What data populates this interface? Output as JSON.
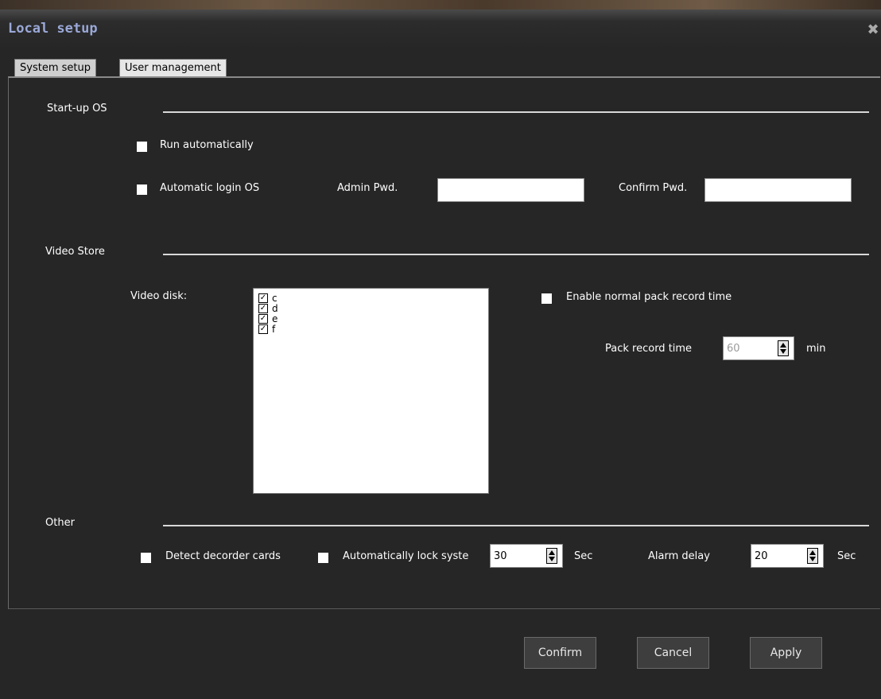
{
  "window": {
    "title": "Local setup",
    "close_icon": "close-icon"
  },
  "tabs": [
    {
      "label": "System setup",
      "selected": false
    },
    {
      "label": "User management",
      "selected": true
    }
  ],
  "startup": {
    "section_label": "Start-up OS",
    "run_auto_label": "Run automatically",
    "run_auto_checked": false,
    "auto_login_label": "Automatic login OS",
    "auto_login_checked": false,
    "admin_pwd_label": "Admin Pwd.",
    "admin_pwd_value": "",
    "confirm_pwd_label": "Confirm Pwd.",
    "confirm_pwd_value": ""
  },
  "video_store": {
    "section_label": "Video Store",
    "disk_label": "Video disk:",
    "disks": [
      {
        "name": "c",
        "checked": true
      },
      {
        "name": "d",
        "checked": true
      },
      {
        "name": "e",
        "checked": true
      },
      {
        "name": "f",
        "checked": true
      }
    ],
    "enable_pack_label": "Enable normal pack record time",
    "enable_pack_checked": false,
    "pack_time_label": "Pack record time",
    "pack_time_value": "60",
    "pack_time_unit": "min"
  },
  "other": {
    "section_label": "Other",
    "detect_label": "Detect decorder cards",
    "detect_checked": false,
    "auto_lock_label": "Automatically lock syste",
    "auto_lock_checked": false,
    "auto_lock_value": "30",
    "auto_lock_unit": "Sec",
    "alarm_label": "Alarm delay",
    "alarm_value": "20",
    "alarm_unit": "Sec"
  },
  "buttons": {
    "confirm": "Confirm",
    "cancel": "Cancel",
    "apply": "Apply"
  },
  "colors": {
    "background": "#262626",
    "title_text": "#9aa8d8",
    "checkbox": "#ffffff"
  }
}
